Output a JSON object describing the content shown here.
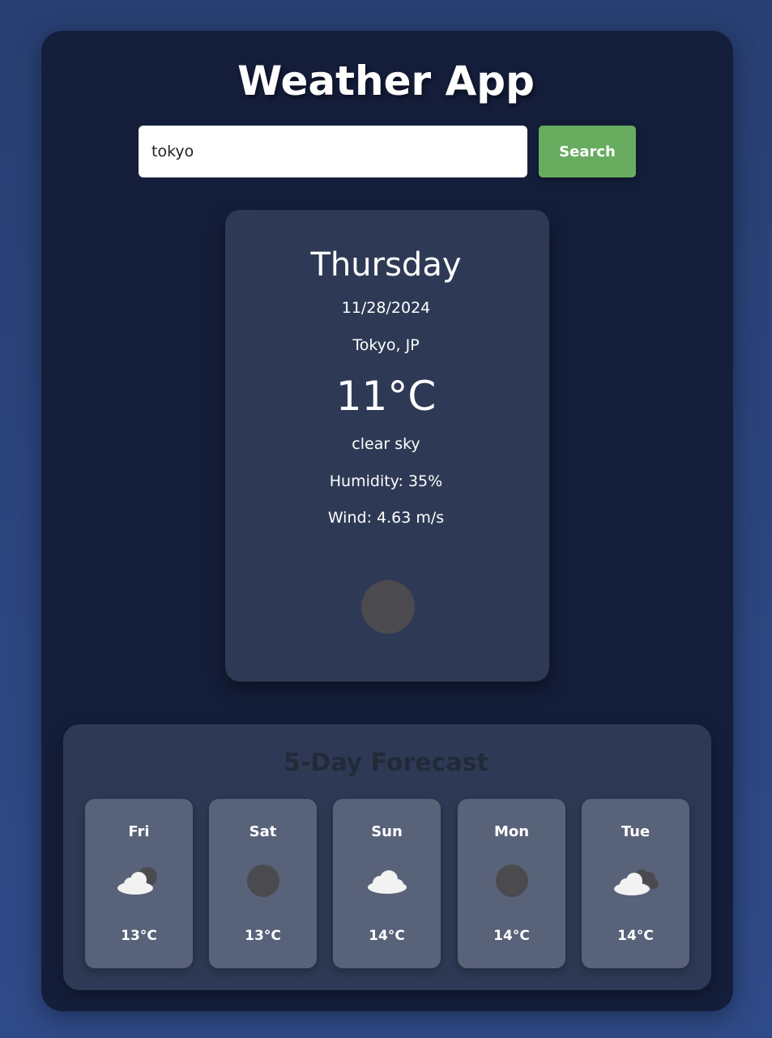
{
  "header": {
    "title": "Weather App"
  },
  "search": {
    "value": "tokyo",
    "button_label": "Search"
  },
  "current": {
    "day": "Thursday",
    "date": "11/28/2024",
    "location": "Tokyo, JP",
    "temperature": "11°C",
    "description": "clear sky",
    "humidity": "Humidity: 35%",
    "wind": "Wind: 4.63 m/s",
    "icon": "clear-sky-dark-circle-icon"
  },
  "forecast": {
    "title": "5-Day Forecast",
    "days": [
      {
        "day": "Fri",
        "temp": "13°C",
        "icon": "cloud-with-dark-circle-icon"
      },
      {
        "day": "Sat",
        "temp": "13°C",
        "icon": "dark-circle-icon"
      },
      {
        "day": "Sun",
        "temp": "14°C",
        "icon": "cloud-icon"
      },
      {
        "day": "Mon",
        "temp": "14°C",
        "icon": "dark-circle-icon"
      },
      {
        "day": "Tue",
        "temp": "14°C",
        "icon": "cloud-with-dark-clouds-icon"
      }
    ]
  },
  "colors": {
    "page_background": "#2c4580",
    "app_background": "#141e3a",
    "card_background": "#2e3a55",
    "forecast_card_background": "#586279",
    "search_button": "#68ac5f",
    "icon_dark": "#4b4b4f"
  }
}
